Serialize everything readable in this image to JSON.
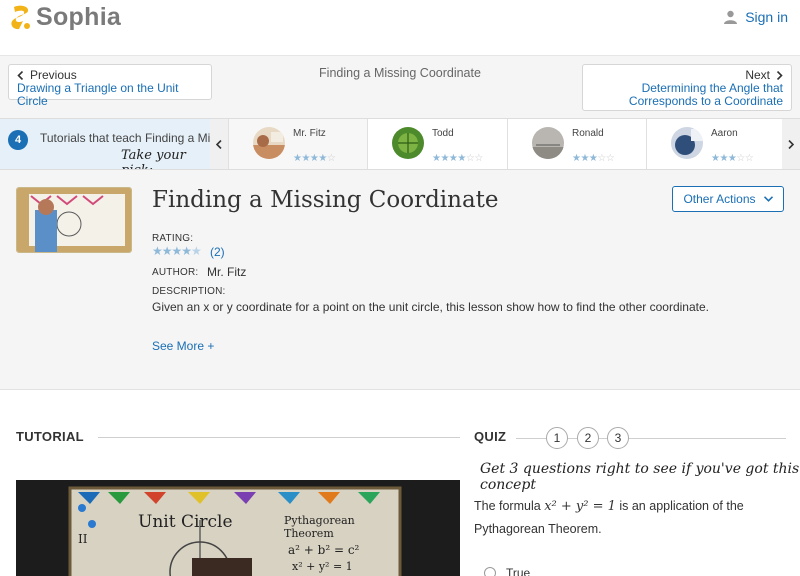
{
  "header": {
    "brand": "Sophia",
    "signin_label": "Sign in",
    "brand_color": "#f2b318",
    "link_color": "#1a6fb5"
  },
  "nav": {
    "previous_label": "Previous",
    "previous_title": "Drawing a Triangle on the Unit Circle",
    "current_title": "Finding a Missing Coordinate",
    "next_label": "Next",
    "next_title_line1": "Determining the Angle that",
    "next_title_line2": "Corresponds to a Coordinate"
  },
  "tutorials": {
    "count": "4",
    "text": "Tutorials that teach Finding a Missing Coordinate",
    "pick_label": "Take your pick:",
    "teachers": [
      {
        "name": "Mr. Fitz",
        "stars": 4,
        "selected": true
      },
      {
        "name": "Todd",
        "stars": 3.5,
        "selected": false
      },
      {
        "name": "Ronald",
        "stars": 3,
        "selected": false
      },
      {
        "name": "Aaron",
        "stars": 3,
        "selected": false
      }
    ]
  },
  "lesson": {
    "title": "Finding a Missing Coordinate",
    "other_actions": "Other Actions",
    "rating_label": "RATING:",
    "rating_stars": 4.5,
    "rating_count": "(2)",
    "author_label": "AUTHOR:",
    "author": "Mr. Fitz",
    "description_label": "DESCRIPTION:",
    "description": "Given an x or y coordinate for a point on the unit circle, this lesson show how to find the other coordinate.",
    "see_more": "See More +"
  },
  "tutorial_section": {
    "heading": "TUTORIAL",
    "video_board_title": "Unit Circle",
    "video_board_subtitle": "Pythagorean Theorem",
    "video_formula": "a² + b² = c²",
    "video_formula2": "x² + y² = 1"
  },
  "quiz": {
    "heading": "QUIZ",
    "steps": [
      "1",
      "2",
      "3"
    ],
    "instruction": "Get 3 questions right to see if you've got this concept",
    "question_prefix": "The formula",
    "question_formula": "x² + y² = 1",
    "question_suffix": "is an application of the Pythagorean Theorem.",
    "options": [
      "True"
    ]
  }
}
